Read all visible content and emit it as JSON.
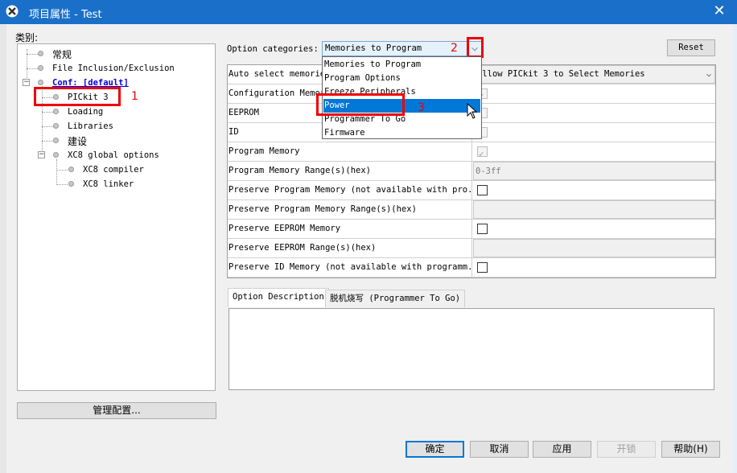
{
  "window": {
    "title": "项目属性 - Test",
    "close_glyph": "✕",
    "accent_color": "#1a70c8"
  },
  "categories": {
    "label": "类别:",
    "items": [
      {
        "label": "常规"
      },
      {
        "label": "File Inclusion/Exclusion"
      },
      {
        "label": "Conf: [default]"
      },
      {
        "label": "PICkit 3"
      },
      {
        "label": "Loading"
      },
      {
        "label": "Libraries"
      },
      {
        "label": "建设"
      },
      {
        "label": "XC8 global options"
      },
      {
        "label": "XC8 compiler"
      },
      {
        "label": "XC8 linker"
      }
    ],
    "manage_label": "管理配置..."
  },
  "options": {
    "categories_label": "Option categories:",
    "selected": "Memories to Program",
    "reset_label": "Reset",
    "dropdown_items": [
      "Memories to Program",
      "Program Options",
      "Freeze Peripherals",
      "Power",
      "Programmer To Go",
      "Firmware"
    ],
    "dropdown_selected": "Power",
    "rows": [
      {
        "name": "Auto select memories and ranges",
        "value": "Allow PICkit 3 to Select Memories"
      },
      {
        "name": "Configuration Memory",
        "value": ""
      },
      {
        "name": "EEPROM",
        "value": ""
      },
      {
        "name": "ID",
        "value": ""
      },
      {
        "name": "Program Memory",
        "value": ""
      },
      {
        "name": "Program Memory Range(s)(hex)",
        "value": "0-3ff"
      },
      {
        "name": "Preserve Program Memory (not available with pro...",
        "value": ""
      },
      {
        "name": "Preserve Program Memory Range(s)(hex)",
        "value": ""
      },
      {
        "name": "Preserve EEPROM Memory",
        "value": ""
      },
      {
        "name": "Preserve EEPROM Range(s)(hex)",
        "value": ""
      },
      {
        "name": "Preserve ID Memory (not available with programm...",
        "value": ""
      }
    ]
  },
  "tabs": {
    "description": "Option Description",
    "programmer_to_go": "脱机烧写 (Programmer To Go)"
  },
  "annotations": {
    "one": "1",
    "two": "2",
    "three": "3",
    "color": "#ee0000"
  },
  "buttons": {
    "ok": "确定",
    "cancel": "取消",
    "apply": "应用",
    "unlock": "开锁",
    "help": "帮助(H)"
  }
}
